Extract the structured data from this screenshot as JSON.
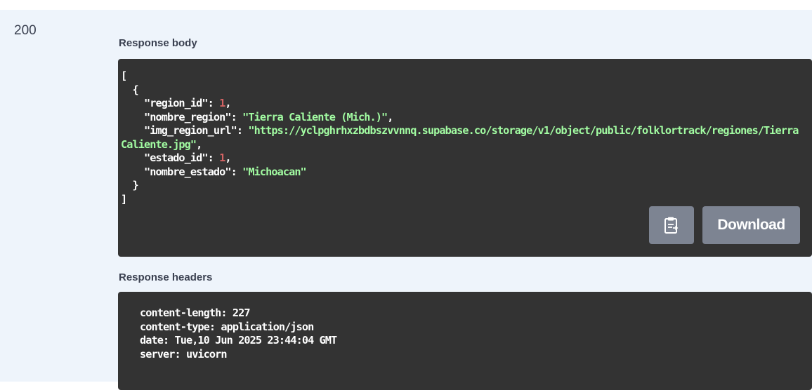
{
  "response": {
    "status_code": "200",
    "body_title": "Response body",
    "headers_title": "Response headers"
  },
  "body": {
    "open_bracket": "[",
    "open_brace": "  {",
    "region_id_key": "    \"region_id\": ",
    "region_id_value": "1",
    "nombre_region_key": "    \"nombre_region\": ",
    "nombre_region_value": "\"Tierra Caliente (Mich.)\"",
    "img_region_url_key": "    \"img_region_url\": ",
    "img_region_url_value": "\"https://yclpghrhxzbdbszvvnnq.supabase.co/storage/v1/object/public/folklortrack/regiones/TierraCaliente.jpg\"",
    "estado_id_key": "    \"estado_id\": ",
    "estado_id_value": "1",
    "nombre_estado_key": "    \"nombre_estado\": ",
    "nombre_estado_value": "\"Michoacan\"",
    "close_brace": "  }",
    "close_bracket": "]",
    "comma": ","
  },
  "headers": {
    "lines": [
      "content-length: 227",
      "content-type: application/json",
      "date: Tue,10 Jun 2025 23:44:04 GMT",
      "server: uvicorn"
    ]
  },
  "buttons": {
    "copy_icon": "clipboard-icon",
    "download_label": "Download"
  },
  "colors": {
    "panel_bg": "#eef4fb",
    "code_bg": "#333333",
    "string": "#a2fca2",
    "number": "#d36363",
    "button_bg": "#7d8492"
  }
}
